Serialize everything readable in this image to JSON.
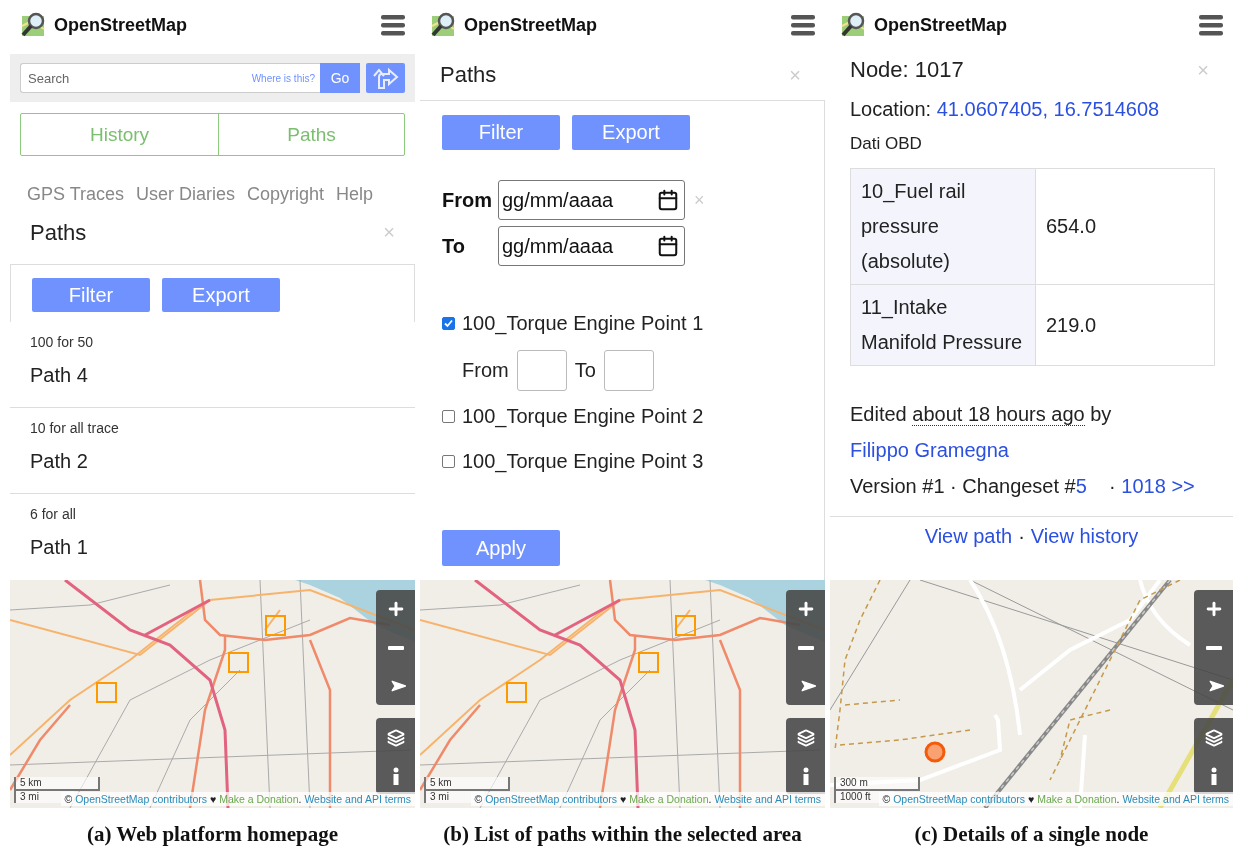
{
  "panels": [
    {
      "kind": "homepage",
      "header": {
        "title": "OpenStreetMap"
      },
      "search": {
        "placeholder": "Search",
        "hint": "Where is this?",
        "go": "Go"
      },
      "tabs": [
        {
          "label": "History"
        },
        {
          "label": "Paths"
        }
      ],
      "nav_links": [
        "GPS Traces",
        "User Diaries",
        "Copyright",
        "Help"
      ],
      "sidebar": {
        "title": "Paths",
        "close": "×",
        "buttons": [
          "Filter",
          "Export"
        ],
        "paths": [
          {
            "subtitle": "100 for 50",
            "name": "Path 4"
          },
          {
            "subtitle": "10 for all trace",
            "name": "Path 2"
          },
          {
            "subtitle": "6 for all",
            "name": "Path 1"
          }
        ]
      },
      "map": {
        "kind": "routes",
        "scale": [
          "5 km",
          "3 mi"
        ],
        "attribution": [
          {
            "kind": "text",
            "text": "© "
          },
          {
            "kind": "link",
            "text": "OpenStreetMap contributors"
          },
          {
            "kind": "text",
            "text": " ♥ "
          },
          {
            "kind": "donate",
            "text": "Make a Donation"
          },
          {
            "kind": "text",
            "text": ". "
          },
          {
            "kind": "link",
            "text": "Website and API terms"
          }
        ]
      },
      "caption": "(a) Web platform homepage"
    },
    {
      "kind": "paths",
      "header": {
        "title": "OpenStreetMap"
      },
      "sidebar": {
        "title": "Paths",
        "close": "×",
        "buttons": [
          "Filter",
          "Export"
        ],
        "date_filters": [
          {
            "label": "From",
            "placeholder": "gg/mm/aaaa",
            "clear": "×"
          },
          {
            "label": "To",
            "placeholder": "gg/mm/aaaa"
          }
        ],
        "sensors": [
          {
            "label": "100_Torque Engine Point 1",
            "checked": true,
            "range": [
              "From",
              "To"
            ]
          },
          {
            "label": "100_Torque Engine Point 2",
            "checked": false
          },
          {
            "label": "100_Torque Engine Point 3",
            "checked": false
          }
        ],
        "apply": "Apply"
      },
      "map": {
        "kind": "routes",
        "scale": [
          "5 km",
          "3 mi"
        ],
        "attribution": [
          {
            "kind": "text",
            "text": "© "
          },
          {
            "kind": "link",
            "text": "OpenStreetMap contributors"
          },
          {
            "kind": "text",
            "text": " ♥ "
          },
          {
            "kind": "donate",
            "text": "Make a Donation"
          },
          {
            "kind": "text",
            "text": ". "
          },
          {
            "kind": "link",
            "text": "Website and API terms"
          }
        ]
      },
      "caption": "(b) List of paths within the selected area"
    },
    {
      "kind": "node",
      "header": {
        "title": "OpenStreetMap"
      },
      "node": {
        "title": "Node: 1017",
        "close": "×",
        "location_label": "Location:",
        "location": "41.0607405, 16.7514608",
        "section": "Dati OBD",
        "table": [
          [
            "10_Fuel rail pressure (absolute)",
            "654.0"
          ],
          [
            "11_Intake Manifold Pressure",
            "219.0"
          ]
        ],
        "edited": {
          "prefix": "Edited",
          "time": "about 18 hours ago",
          "by": "by",
          "user": "Filippo Gramegna"
        },
        "version": {
          "version": "Version #1",
          "separator": "·",
          "changeset_label": "Changeset #",
          "changeset": "5",
          "next": "1018 >>"
        },
        "links": [
          "View path",
          "View history"
        ],
        "links_separator": "·"
      },
      "map": {
        "kind": "node",
        "scale": [
          "300 m",
          "1000 ft"
        ],
        "attribution": [
          {
            "kind": "text",
            "text": "© "
          },
          {
            "kind": "link",
            "text": "OpenStreetMap contributors"
          },
          {
            "kind": "text",
            "text": " ♥ "
          },
          {
            "kind": "donate",
            "text": "Make a Donation"
          },
          {
            "kind": "text",
            "text": ". "
          },
          {
            "kind": "link",
            "text": "Website and API terms"
          }
        ]
      },
      "caption": "(c) Details of a single node"
    }
  ]
}
